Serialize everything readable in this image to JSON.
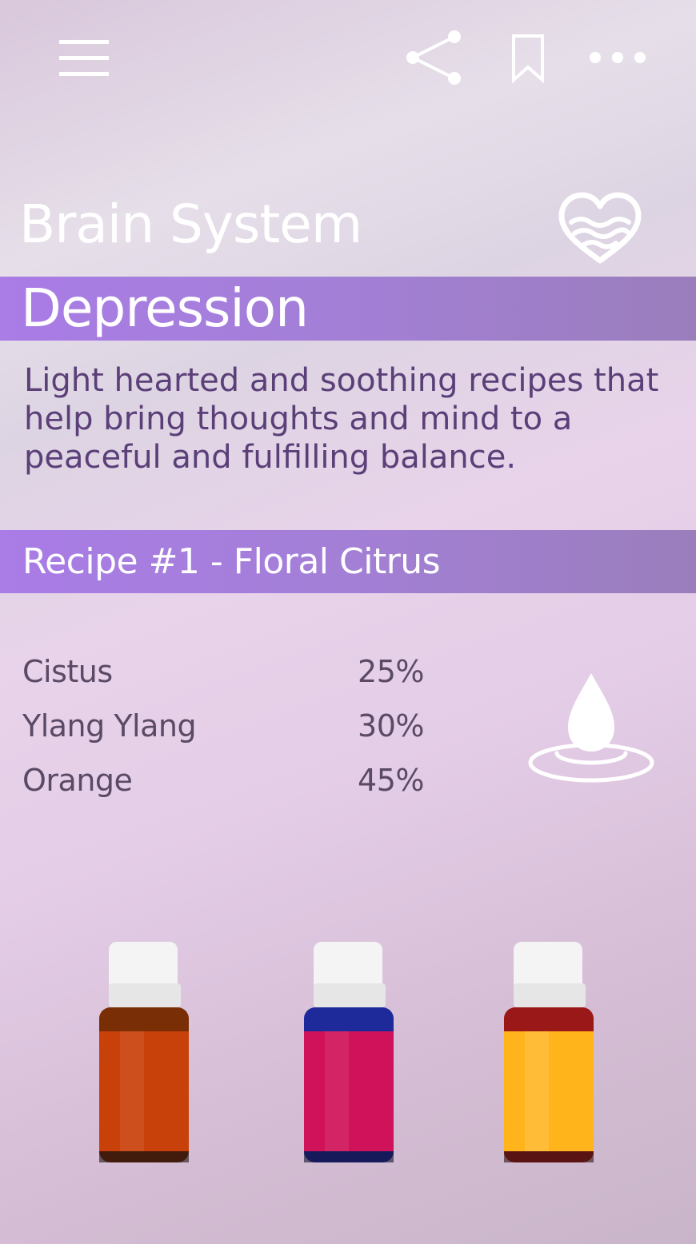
{
  "topbar": {
    "icons": [
      "menu-icon",
      "share-icon",
      "bookmark-icon",
      "more-icon"
    ]
  },
  "header": {
    "section_title": "Brain System",
    "section_icon": "heart-waves-icon"
  },
  "condition": {
    "title": "Depression",
    "description": "Light hearted and soothing recipes that help bring thoughts and mind to a peaceful and fulfilling balance."
  },
  "recipe": {
    "title": "Recipe #1 - Floral Citrus",
    "icon": "oil-drop-icon",
    "ingredients": [
      {
        "name": "Cistus",
        "percent": "25%"
      },
      {
        "name": "Ylang Ylang",
        "percent": "30%"
      },
      {
        "name": "Orange",
        "percent": "45%"
      }
    ]
  },
  "bottles": [
    {
      "label_color": "#c8410a",
      "glass_color": "#7a2e05"
    },
    {
      "label_color": "#d0125a",
      "glass_color": "#1f2a9a"
    },
    {
      "label_color": "#ffb41c",
      "glass_color": "#9a1818"
    }
  ],
  "colors": {
    "accent_band": "#a47fd8",
    "description_text": "#5b3f78",
    "ingredient_text": "#5a4a66"
  }
}
